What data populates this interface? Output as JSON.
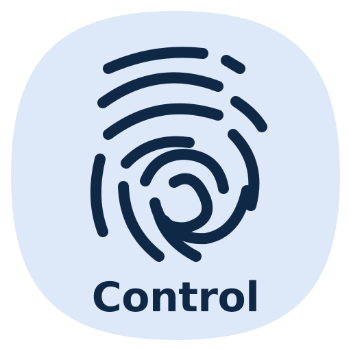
{
  "app_icon": {
    "name": "Control",
    "icon": "fingerprint-icon",
    "colors": {
      "background": "#dde9f9",
      "foreground": "#0f2846"
    }
  }
}
